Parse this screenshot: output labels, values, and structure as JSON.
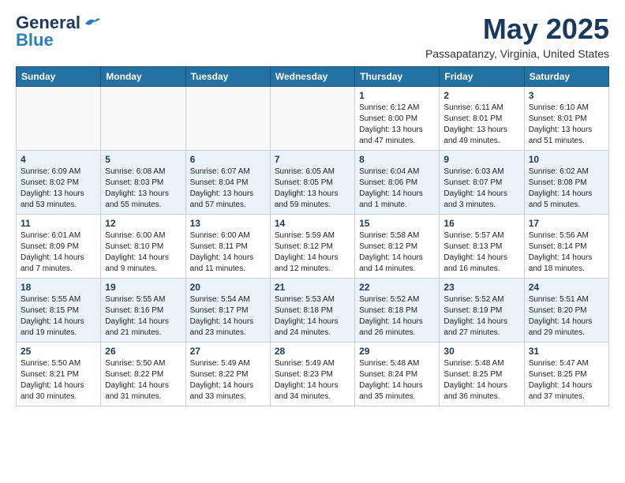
{
  "header": {
    "logo_general": "General",
    "logo_blue": "Blue",
    "month_title": "May 2025",
    "location": "Passapatanzy, Virginia, United States"
  },
  "weekdays": [
    "Sunday",
    "Monday",
    "Tuesday",
    "Wednesday",
    "Thursday",
    "Friday",
    "Saturday"
  ],
  "weeks": [
    [
      {
        "day": "",
        "info": ""
      },
      {
        "day": "",
        "info": ""
      },
      {
        "day": "",
        "info": ""
      },
      {
        "day": "",
        "info": ""
      },
      {
        "day": "1",
        "info": "Sunrise: 6:12 AM\nSunset: 8:00 PM\nDaylight: 13 hours\nand 47 minutes."
      },
      {
        "day": "2",
        "info": "Sunrise: 6:11 AM\nSunset: 8:01 PM\nDaylight: 13 hours\nand 49 minutes."
      },
      {
        "day": "3",
        "info": "Sunrise: 6:10 AM\nSunset: 8:01 PM\nDaylight: 13 hours\nand 51 minutes."
      }
    ],
    [
      {
        "day": "4",
        "info": "Sunrise: 6:09 AM\nSunset: 8:02 PM\nDaylight: 13 hours\nand 53 minutes."
      },
      {
        "day": "5",
        "info": "Sunrise: 6:08 AM\nSunset: 8:03 PM\nDaylight: 13 hours\nand 55 minutes."
      },
      {
        "day": "6",
        "info": "Sunrise: 6:07 AM\nSunset: 8:04 PM\nDaylight: 13 hours\nand 57 minutes."
      },
      {
        "day": "7",
        "info": "Sunrise: 6:05 AM\nSunset: 8:05 PM\nDaylight: 13 hours\nand 59 minutes."
      },
      {
        "day": "8",
        "info": "Sunrise: 6:04 AM\nSunset: 8:06 PM\nDaylight: 14 hours\nand 1 minute."
      },
      {
        "day": "9",
        "info": "Sunrise: 6:03 AM\nSunset: 8:07 PM\nDaylight: 14 hours\nand 3 minutes."
      },
      {
        "day": "10",
        "info": "Sunrise: 6:02 AM\nSunset: 8:08 PM\nDaylight: 14 hours\nand 5 minutes."
      }
    ],
    [
      {
        "day": "11",
        "info": "Sunrise: 6:01 AM\nSunset: 8:09 PM\nDaylight: 14 hours\nand 7 minutes."
      },
      {
        "day": "12",
        "info": "Sunrise: 6:00 AM\nSunset: 8:10 PM\nDaylight: 14 hours\nand 9 minutes."
      },
      {
        "day": "13",
        "info": "Sunrise: 6:00 AM\nSunset: 8:11 PM\nDaylight: 14 hours\nand 11 minutes."
      },
      {
        "day": "14",
        "info": "Sunrise: 5:59 AM\nSunset: 8:12 PM\nDaylight: 14 hours\nand 12 minutes."
      },
      {
        "day": "15",
        "info": "Sunrise: 5:58 AM\nSunset: 8:12 PM\nDaylight: 14 hours\nand 14 minutes."
      },
      {
        "day": "16",
        "info": "Sunrise: 5:57 AM\nSunset: 8:13 PM\nDaylight: 14 hours\nand 16 minutes."
      },
      {
        "day": "17",
        "info": "Sunrise: 5:56 AM\nSunset: 8:14 PM\nDaylight: 14 hours\nand 18 minutes."
      }
    ],
    [
      {
        "day": "18",
        "info": "Sunrise: 5:55 AM\nSunset: 8:15 PM\nDaylight: 14 hours\nand 19 minutes."
      },
      {
        "day": "19",
        "info": "Sunrise: 5:55 AM\nSunset: 8:16 PM\nDaylight: 14 hours\nand 21 minutes."
      },
      {
        "day": "20",
        "info": "Sunrise: 5:54 AM\nSunset: 8:17 PM\nDaylight: 14 hours\nand 23 minutes."
      },
      {
        "day": "21",
        "info": "Sunrise: 5:53 AM\nSunset: 8:18 PM\nDaylight: 14 hours\nand 24 minutes."
      },
      {
        "day": "22",
        "info": "Sunrise: 5:52 AM\nSunset: 8:18 PM\nDaylight: 14 hours\nand 26 minutes."
      },
      {
        "day": "23",
        "info": "Sunrise: 5:52 AM\nSunset: 8:19 PM\nDaylight: 14 hours\nand 27 minutes."
      },
      {
        "day": "24",
        "info": "Sunrise: 5:51 AM\nSunset: 8:20 PM\nDaylight: 14 hours\nand 29 minutes."
      }
    ],
    [
      {
        "day": "25",
        "info": "Sunrise: 5:50 AM\nSunset: 8:21 PM\nDaylight: 14 hours\nand 30 minutes."
      },
      {
        "day": "26",
        "info": "Sunrise: 5:50 AM\nSunset: 8:22 PM\nDaylight: 14 hours\nand 31 minutes."
      },
      {
        "day": "27",
        "info": "Sunrise: 5:49 AM\nSunset: 8:22 PM\nDaylight: 14 hours\nand 33 minutes."
      },
      {
        "day": "28",
        "info": "Sunrise: 5:49 AM\nSunset: 8:23 PM\nDaylight: 14 hours\nand 34 minutes."
      },
      {
        "day": "29",
        "info": "Sunrise: 5:48 AM\nSunset: 8:24 PM\nDaylight: 14 hours\nand 35 minutes."
      },
      {
        "day": "30",
        "info": "Sunrise: 5:48 AM\nSunset: 8:25 PM\nDaylight: 14 hours\nand 36 minutes."
      },
      {
        "day": "31",
        "info": "Sunrise: 5:47 AM\nSunset: 8:25 PM\nDaylight: 14 hours\nand 37 minutes."
      }
    ]
  ]
}
